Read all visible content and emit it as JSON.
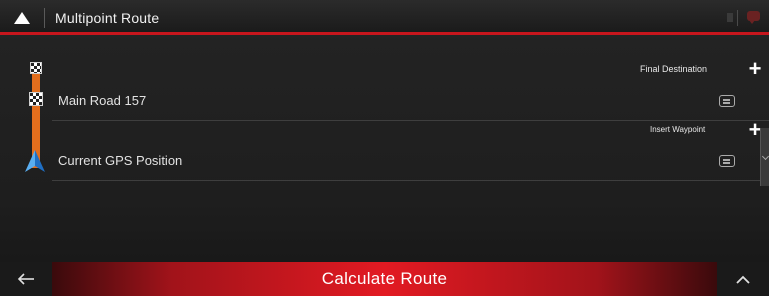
{
  "header": {
    "title": "Multipoint Route"
  },
  "route": {
    "final_destination_label": "Final Destination",
    "insert_waypoint_label": "Insert Waypoint",
    "destination": "Main Road 157",
    "start": "Current GPS Position"
  },
  "footer": {
    "calculate_label": "Calculate Route"
  },
  "colors": {
    "accent_red": "#e21a22",
    "route_line": "#e36e1d",
    "gps_arrow": "#3a8fe0"
  },
  "icons": {
    "home": "navigation-arrow-icon",
    "flag": "checkered-flag-icon",
    "gps": "gps-arrow-icon",
    "note": "note-icon",
    "add": "plus-icon",
    "back": "back-arrow-icon",
    "up": "chevron-up-icon"
  }
}
